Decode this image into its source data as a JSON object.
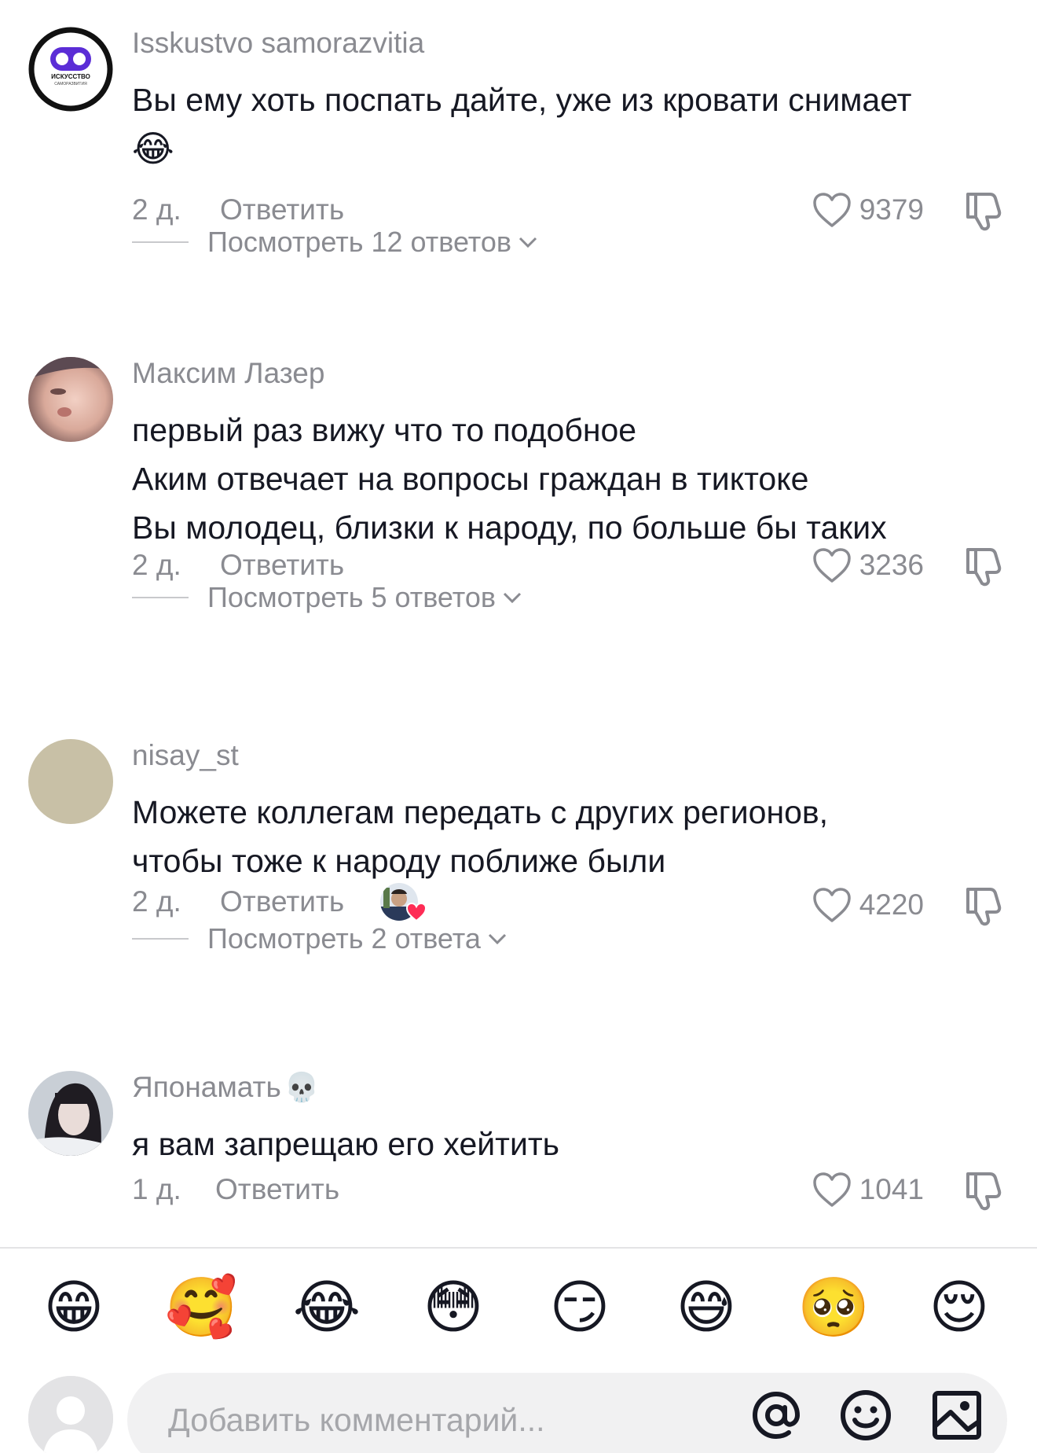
{
  "comments": [
    {
      "username": "Isskustvo samorazvitia",
      "lines": [
        "Вы ему хоть поспать дайте, уже из кровати снимает"
      ],
      "trailing_emoji": "😂",
      "time": "2 д.",
      "reply_label": "Ответить",
      "likes": "9379",
      "view_replies": "Посмотреть 12 ответов",
      "avatar_brand": {
        "line1": "ИСКУССТВО",
        "line2": "САМОРАЗВИТИЯ",
        "accent": "#5b2dd6"
      }
    },
    {
      "username": "Максим Лазер",
      "lines": [
        "первый раз вижу что то подобное",
        "Аким отвечает на вопросы граждан в тиктоке",
        "Вы молодец, близки к народу, по больше бы таких"
      ],
      "time": "2 д.",
      "reply_label": "Ответить",
      "likes": "3236",
      "view_replies": "Посмотреть 5 ответов"
    },
    {
      "username": "nisay_st",
      "lines": [
        "Можете коллегам передать с других регионов,",
        "чтобы тоже к народу поближе были"
      ],
      "time": "2 д.",
      "reply_label": "Ответить",
      "likes": "4220",
      "view_replies": "Посмотреть 2 ответа",
      "creator_liked": true
    },
    {
      "username": "Японамать",
      "username_emoji": "💀",
      "lines": [
        "я вам запрещаю его хейтить"
      ],
      "time": "1 д.",
      "reply_label": "Ответить",
      "likes": "1041"
    }
  ],
  "quick_emojis": [
    "😁",
    "🥰",
    "😂",
    "😳",
    "😏",
    "😅",
    "🥺",
    "😌"
  ],
  "composer": {
    "placeholder": "Добавить комментарий...",
    "tools": [
      "at-icon",
      "emoji-icon",
      "image-icon"
    ]
  },
  "colors": {
    "text_primary": "#161823",
    "text_secondary": "#8a8b91",
    "heart_red": "#fe2c55",
    "input_bg": "#f1f1f2"
  }
}
